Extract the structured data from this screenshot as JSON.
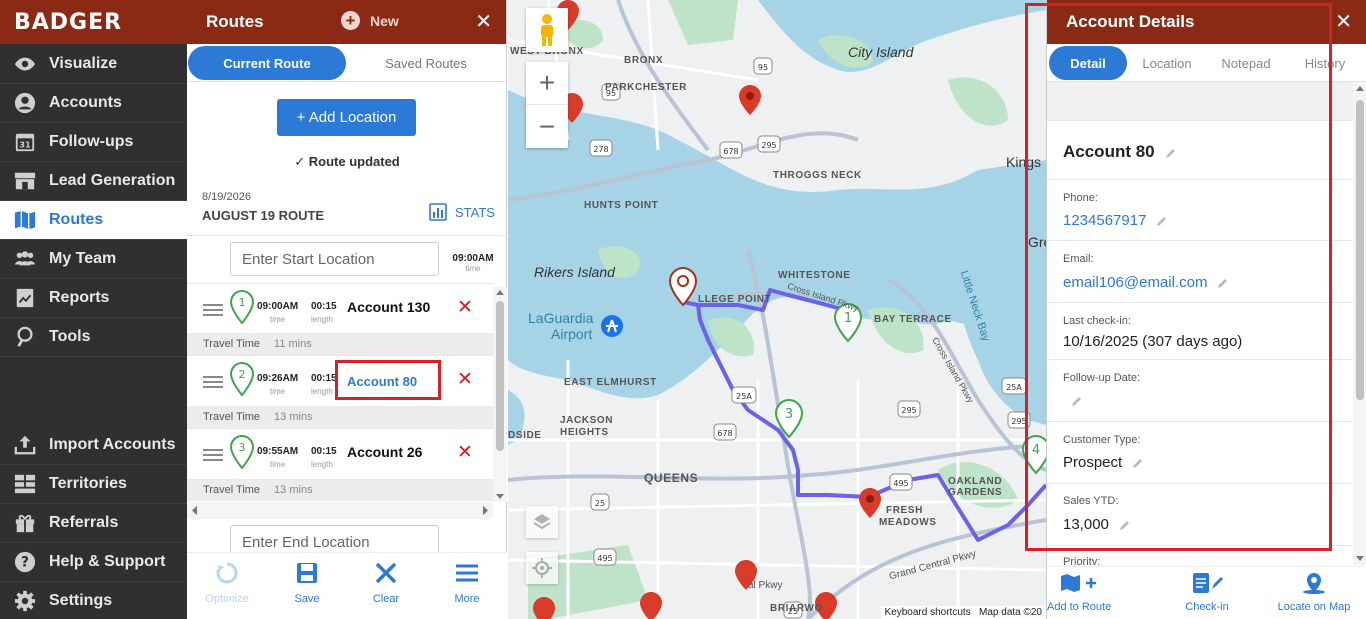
{
  "brand": {
    "logo": "BADGER"
  },
  "nav": {
    "items": [
      {
        "label": "Visualize",
        "icon": "eye-icon"
      },
      {
        "label": "Accounts",
        "icon": "account-icon"
      },
      {
        "label": "Follow-ups",
        "icon": "calendar-icon"
      },
      {
        "label": "Lead Generation",
        "icon": "storefront-icon"
      },
      {
        "label": "Routes",
        "icon": "map-icon"
      },
      {
        "label": "My Team",
        "icon": "team-icon"
      },
      {
        "label": "Reports",
        "icon": "report-icon"
      },
      {
        "label": "Tools",
        "icon": "tools-icon"
      },
      {
        "label": "Import Accounts",
        "icon": "upload-icon"
      },
      {
        "label": "Territories",
        "icon": "territories-icon"
      },
      {
        "label": "Referrals",
        "icon": "gift-icon"
      },
      {
        "label": "Help & Support",
        "icon": "help-icon"
      },
      {
        "label": "Settings",
        "icon": "gear-icon"
      }
    ],
    "active": "Routes"
  },
  "routes_panel": {
    "title": "Routes",
    "new_label": "New",
    "close": "✕",
    "tabs": [
      {
        "label": "Current Route"
      },
      {
        "label": "Saved Routes"
      }
    ],
    "add_location": "+ Add Location",
    "status": "Route updated",
    "date": "8/19/2026",
    "route_name": "AUGUST 19 ROUTE",
    "stats_label": "STATS",
    "start_placeholder": "Enter Start Location",
    "start_time": "09:00AM",
    "start_time_sub": "time",
    "end_placeholder": "Enter End Location",
    "stops": [
      {
        "num": "1",
        "time": "09:00AM",
        "time_sub": "time",
        "length": "00:15",
        "length_sub": "length",
        "account": "Account 130",
        "travel_label": "Travel Time",
        "travel": "11 mins"
      },
      {
        "num": "2",
        "time": "09:26AM",
        "time_sub": "time",
        "length": "00:15",
        "length_sub": "length",
        "account": "Account 80",
        "travel_label": "Travel Time",
        "travel": "13 mins"
      },
      {
        "num": "3",
        "time": "09:55AM",
        "time_sub": "time",
        "length": "00:15",
        "length_sub": "length",
        "account": "Account 26",
        "travel_label": "Travel Time",
        "travel": "13 mins"
      }
    ],
    "bottom": [
      {
        "label": "Optimize",
        "icon": "optimize-icon",
        "disabled": true
      },
      {
        "label": "Save",
        "icon": "save-icon"
      },
      {
        "label": "Clear",
        "icon": "clear-icon"
      },
      {
        "label": "More",
        "icon": "menu-icon"
      }
    ]
  },
  "map": {
    "labels": {
      "west_bronx": "WEST BRONX",
      "bronx": "BRONX",
      "parkchester": "PARKCHESTER",
      "city_island": "City Island",
      "throggs_neck": "THROGGS NECK",
      "hunts_point": "HUNTS POINT",
      "rikers_island": "Rikers Island",
      "whitestone": "WHITESTONE",
      "college_point": "LLEGE POINT",
      "laguardia": "LaGuardia",
      "airport": "Airport",
      "bay_terrace": "BAY TERRACE",
      "east_elmhurst": "EAST ELMHURST",
      "jackson_heights": "JACKSON",
      "heights": "HEIGHTS",
      "queens": "QUEENS",
      "fresh_meadows": "FRESH",
      "meadows": "MEADOWS",
      "oakland": "OAKLAND",
      "gardens": "GARDENS",
      "briarwood": "BRIARWO",
      "kings": "Kings",
      "gre": "Gre",
      "little_neck_bay": "Little Neck Bay",
      "cross_island": "Cross Island Pkwy",
      "cross_island2": "Cross Island Pkwy",
      "grand_central": "Grand Central Pkwy",
      "dside": "DSIDE",
      "pkwy": "al Pkwy"
    },
    "shields": [
      "95",
      "95",
      "278",
      "678",
      "295",
      "25A",
      "678",
      "295",
      "495",
      "25",
      "495",
      "25",
      "25A",
      "295"
    ],
    "markers": {
      "m1": "1",
      "m3": "3",
      "m4": "4"
    },
    "zoom_in": "+",
    "zoom_out": "−",
    "footer_shortcuts": "Keyboard shortcuts",
    "footer_data": "Map data ©20"
  },
  "account_panel": {
    "title": "Account Details",
    "close": "✕",
    "tabs": [
      {
        "label": "Detail"
      },
      {
        "label": "Location"
      },
      {
        "label": "Notepad"
      },
      {
        "label": "History"
      }
    ],
    "name": "Account 80",
    "fields": {
      "phone_label": "Phone:",
      "phone": "1234567917",
      "email_label": "Email:",
      "email": "email106@email.com",
      "checkin_label": "Last check-in:",
      "checkin": "10/16/2025 (307 days ago)",
      "followup_label": "Follow-up Date:",
      "customer_type_label": "Customer Type:",
      "customer_type": "Prospect",
      "sales_label": "Sales YTD:",
      "sales": "13,000",
      "priority_label": "Priority:"
    },
    "bottom": [
      {
        "label": "Add to Route",
        "icon": "add-route-icon"
      },
      {
        "label": "Check-in",
        "icon": "checkin-icon"
      },
      {
        "label": "Locate on Map",
        "icon": "locate-icon"
      }
    ]
  },
  "colors": {
    "header": "#8b2a14",
    "accent": "#2d7ad6",
    "nav_bg": "#303030",
    "highlight": "#d2232a",
    "route_line": "#6a63e8",
    "water": "#a6d4e6",
    "park": "#bfe3c8"
  }
}
